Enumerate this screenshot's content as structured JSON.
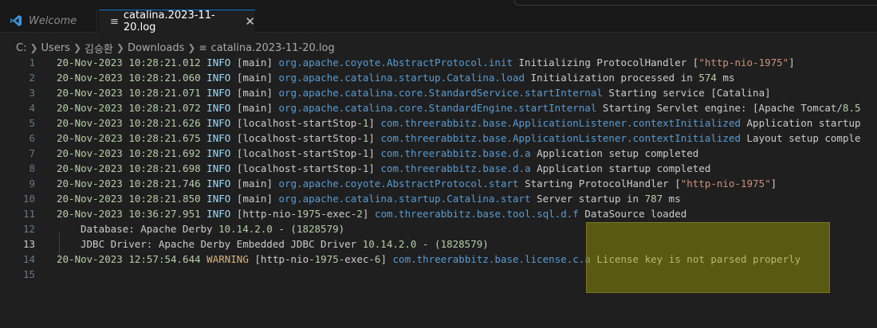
{
  "tabs": [
    {
      "label": "Welcome",
      "icon": "vscode-icon"
    },
    {
      "label": "catalina.2023-11-20.log",
      "icon": "file-lines-icon",
      "close": "✕"
    }
  ],
  "breadcrumb": [
    "C:",
    "Users",
    "김승환",
    "Downloads",
    "catalina.2023-11-20.log"
  ],
  "lines": [
    {
      "n": "1",
      "date": "20-Nov-2023",
      "time": "10:28:21.012",
      "level": "INFO",
      "thread": "[main]",
      "cls": "org.apache.coyote.AbstractProtocol.init",
      "msg": "Initializing ProtocolHandler [\"http-nio-1975\"]"
    },
    {
      "n": "2",
      "date": "20-Nov-2023",
      "time": "10:28:21.060",
      "level": "INFO",
      "thread": "[main]",
      "cls": "org.apache.catalina.startup.Catalina.load",
      "msg": "Initialization processed in 574 ms"
    },
    {
      "n": "3",
      "date": "20-Nov-2023",
      "time": "10:28:21.071",
      "level": "INFO",
      "thread": "[main]",
      "cls": "org.apache.catalina.core.StandardService.startInternal",
      "msg": "Starting service [Catalina]"
    },
    {
      "n": "4",
      "date": "20-Nov-2023",
      "time": "10:28:21.072",
      "level": "INFO",
      "thread": "[main]",
      "cls": "org.apache.catalina.core.StandardEngine.startInternal",
      "msg": "Starting Servlet engine: [Apache Tomcat/8.5"
    },
    {
      "n": "5",
      "date": "20-Nov-2023",
      "time": "10:28:21.626",
      "level": "INFO",
      "thread": "[localhost-startStop-1]",
      "cls": "com.threerabbitz.base.ApplicationListener.contextInitialized",
      "msg": "Application startup"
    },
    {
      "n": "6",
      "date": "20-Nov-2023",
      "time": "10:28:21.675",
      "level": "INFO",
      "thread": "[localhost-startStop-1]",
      "cls": "com.threerabbitz.base.ApplicationListener.contextInitialized",
      "msg": "Layout setup comple"
    },
    {
      "n": "7",
      "date": "20-Nov-2023",
      "time": "10:28:21.692",
      "level": "INFO",
      "thread": "[localhost-startStop-1]",
      "cls": "com.threerabbitz.base.d.a",
      "msg": "Application setup completed"
    },
    {
      "n": "8",
      "date": "20-Nov-2023",
      "time": "10:28:21.698",
      "level": "INFO",
      "thread": "[localhost-startStop-1]",
      "cls": "com.threerabbitz.base.d.a",
      "msg": "Application startup completed"
    },
    {
      "n": "9",
      "date": "20-Nov-2023",
      "time": "10:28:21.746",
      "level": "INFO",
      "thread": "[main]",
      "cls": "org.apache.coyote.AbstractProtocol.start",
      "msg": "Starting ProtocolHandler [\"http-nio-1975\"]"
    },
    {
      "n": "10",
      "date": "20-Nov-2023",
      "time": "10:28:21.850",
      "level": "INFO",
      "thread": "[main]",
      "cls": "org.apache.catalina.startup.Catalina.start",
      "msg": "Server startup in 787 ms"
    },
    {
      "n": "11",
      "date": "20-Nov-2023",
      "time": "10:36:27.951",
      "level": "INFO",
      "thread": "[http-nio-1975-exec-2]",
      "cls": "com.threerabbitz.base.tool.sql.d.f",
      "msg": "DataSource loaded"
    },
    {
      "n": "12",
      "indent": true,
      "text": "Database: Apache Derby 10.14.2.0 - (1828579)"
    },
    {
      "n": "13",
      "indent": true,
      "text": "JDBC Driver: Apache Derby Embedded JDBC Driver 10.14.2.0 - (1828579)"
    },
    {
      "n": "14",
      "date": "20-Nov-2023",
      "time": "12:57:54.644",
      "level": "WARNING",
      "thread": "[http-nio-1975-exec-6]",
      "cls": "com.threerabbitz.base.license.c.a",
      "msg": "License key is not parsed properly"
    },
    {
      "n": "15"
    }
  ],
  "active_line": "13",
  "colors": {
    "accent": "#0078d4",
    "highlight": "#a0a000"
  }
}
